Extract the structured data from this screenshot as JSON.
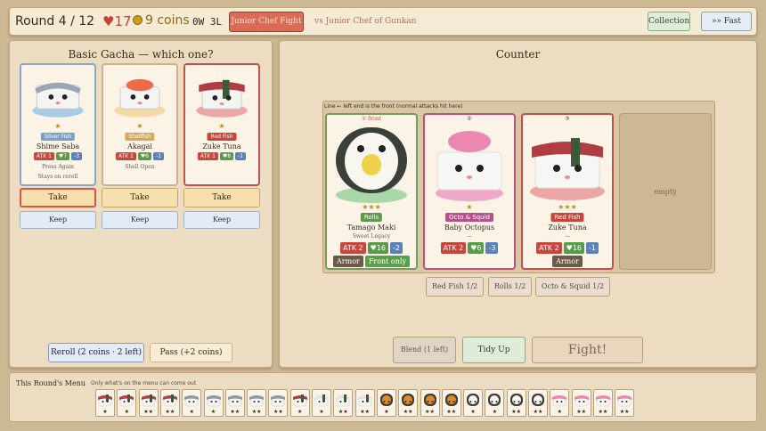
{
  "topbar": {
    "round": "Round 4 / 12",
    "hp": "17",
    "coins": "9 coins",
    "record": "0W 3L",
    "opponent_button": "Junior Chef Fight",
    "vs_text": "vs Junior Chef of Gunkan",
    "collection": "Collection",
    "fast": "»» Fast"
  },
  "shop": {
    "title": "Basic Gacha — which one?",
    "cards": [
      {
        "stars": "★",
        "tag": "Silver Fish",
        "tag_color": "#7aa0c8",
        "name": "Shime Saba",
        "atk": "ATK 1",
        "hp": "♥7",
        "cost": "-3",
        "line1": "Press Again",
        "line2": "Stays on reroll"
      },
      {
        "stars": "★",
        "tag": "Shellfish",
        "tag_color": "#d8a85a",
        "name": "Akagai",
        "atk": "ATK 2",
        "hp": "♥6",
        "cost": "-1",
        "line1": "Shell Open",
        "line2": ""
      },
      {
        "stars": "★",
        "tag": "Red Fish",
        "tag_color": "#c8473d",
        "name": "Zuke Tuna",
        "atk": "ATK 1",
        "hp": "♥8",
        "cost": "-1",
        "line1": "",
        "line2": ""
      }
    ],
    "take": "Take",
    "keep": "Keep",
    "reroll": "Reroll (2 coins · 2 left)",
    "pass": "Pass (+2 coins)"
  },
  "counter": {
    "title": "Counter",
    "line_label": "Line  ← left end is the front (normal attacks hit here)",
    "slots": [
      {
        "idx": "① front",
        "stars": "★★★",
        "tag": "Rolls",
        "tag_color": "#5a9a4a",
        "name": "Tamago Maki",
        "sub": "Sweet Legacy",
        "atk": "ATK 2",
        "hp": "♥16",
        "cost": "-2",
        "keywords": [
          "Armor",
          "Front only"
        ]
      },
      {
        "idx": "②",
        "stars": "★",
        "tag": "Octo & Squid",
        "tag_color": "#b8508a",
        "name": "Baby Octopus",
        "sub": "—",
        "atk": "ATK 2",
        "hp": "♥6",
        "cost": "-3",
        "keywords": []
      },
      {
        "idx": "③",
        "stars": "★★★",
        "tag": "Red Fish",
        "tag_color": "#c8473d",
        "name": "Zuke Tuna",
        "sub": "—",
        "atk": "ATK 2",
        "hp": "♥16",
        "cost": "-1",
        "keywords": [
          "Armor"
        ]
      }
    ],
    "empty": "empty",
    "synergies": [
      "Red Fish 1/2",
      "Rolls 1/2",
      "Octo & Squid 1/2"
    ],
    "blend": "Blend (1 left)",
    "tidy": "Tidy Up",
    "fight": "Fight!"
  },
  "menu": {
    "title": "This Round's Menu",
    "subtitle": "Only what's on the menu can come out",
    "items": [
      {
        "type": "tuna",
        "stars": "★"
      },
      {
        "type": "tuna",
        "stars": "★"
      },
      {
        "type": "tuna",
        "stars": "★★"
      },
      {
        "type": "tuna",
        "stars": "★★"
      },
      {
        "type": "saba",
        "stars": "★"
      },
      {
        "type": "saba",
        "stars": "★"
      },
      {
        "type": "saba",
        "stars": "★★"
      },
      {
        "type": "saba",
        "stars": "★★"
      },
      {
        "type": "saba",
        "stars": "★★"
      },
      {
        "type": "tuna",
        "stars": "★"
      },
      {
        "type": "white",
        "stars": "★"
      },
      {
        "type": "white",
        "stars": "★★"
      },
      {
        "type": "white",
        "stars": "★★"
      },
      {
        "type": "gunkan",
        "stars": "★"
      },
      {
        "type": "gunkan",
        "stars": "★★"
      },
      {
        "type": "gunkan",
        "stars": "★★"
      },
      {
        "type": "gunkan",
        "stars": "★★"
      },
      {
        "type": "maki",
        "stars": "★"
      },
      {
        "type": "maki",
        "stars": "★"
      },
      {
        "type": "maki",
        "stars": "★★"
      },
      {
        "type": "maki",
        "stars": "★★"
      },
      {
        "type": "octo",
        "stars": "★"
      },
      {
        "type": "octo",
        "stars": "★★"
      },
      {
        "type": "octo",
        "stars": "★★"
      },
      {
        "type": "octo",
        "stars": "★★"
      }
    ]
  },
  "colors": {
    "atk": "#c8473d",
    "hp": "#5a9a4a",
    "cost": "#5a82b8",
    "accent_red": "#d96b57"
  }
}
